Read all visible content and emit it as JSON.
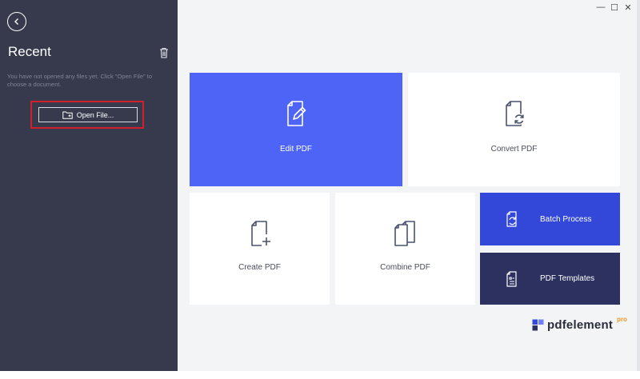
{
  "sidebar": {
    "title": "Recent",
    "empty_message": "You have not opened any files yet. Click \"Open File\" to choose a document.",
    "open_file_label": "Open File..."
  },
  "tiles": {
    "edit": "Edit PDF",
    "convert": "Convert PDF",
    "create": "Create PDF",
    "combine": "Combine PDF",
    "batch": "Batch Process",
    "templates": "PDF Templates"
  },
  "brand": {
    "name": "pdfelement",
    "edition": "pro"
  },
  "window_controls": {
    "minimize": "—",
    "maximize": "☐",
    "close": "✕"
  },
  "colors": {
    "sidebar": "#373a4d",
    "accent_blue": "#4d64f7",
    "batch_blue": "#3347d9",
    "navy": "#2c3160",
    "highlight_red": "#d0202e",
    "pro_orange": "#f39a1e"
  },
  "icons": [
    "back-arrow-icon",
    "trash-icon",
    "folder-icon",
    "edit-document-icon",
    "convert-document-icon",
    "create-document-icon",
    "combine-documents-icon",
    "batch-process-icon",
    "template-icon",
    "pdfelement-logo-icon"
  ]
}
